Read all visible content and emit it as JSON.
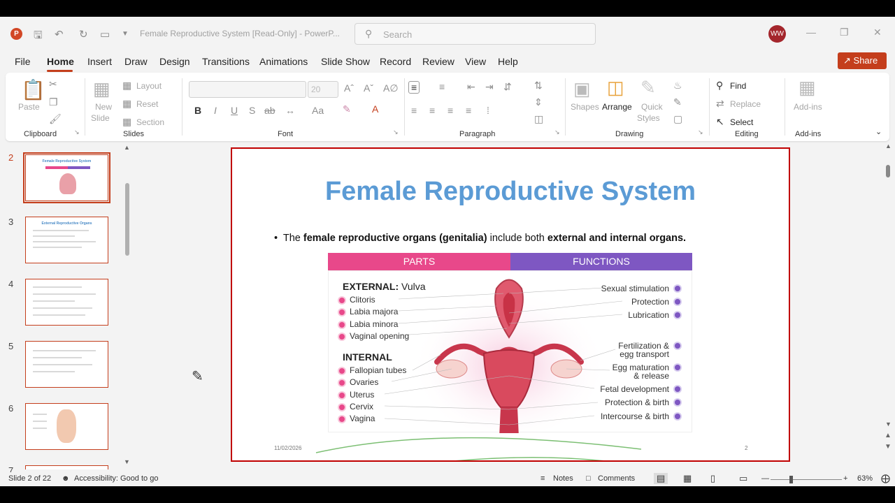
{
  "app": {
    "title": "Female Reproductive System [Read-Only]  -  PowerP...",
    "search_placeholder": "Search",
    "user_initials": "WW"
  },
  "menu": {
    "items": [
      "File",
      "Home",
      "Insert",
      "Draw",
      "Design",
      "Transitions",
      "Animations",
      "Slide Show",
      "Record",
      "Review",
      "View",
      "Help"
    ],
    "active": "Home",
    "share_label": "Share"
  },
  "ribbon": {
    "clipboard": {
      "label": "Clipboard",
      "paste": "Paste"
    },
    "slides": {
      "label": "Slides",
      "new_slide_1": "New",
      "new_slide_2": "Slide",
      "layout": "Layout",
      "reset": "Reset",
      "section": "Section"
    },
    "font": {
      "label": "Font",
      "size": "20",
      "bold": "B",
      "italic": "I",
      "underline": "U",
      "shadow": "S",
      "strike": "ab",
      "case": "Aa"
    },
    "paragraph": {
      "label": "Paragraph"
    },
    "drawing": {
      "label": "Drawing",
      "shapes": "Shapes",
      "arrange": "Arrange",
      "quick_1": "Quick",
      "quick_2": "Styles"
    },
    "editing": {
      "label": "Editing",
      "find": "Find",
      "replace": "Replace",
      "select": "Select"
    },
    "addins": {
      "label": "Add-ins",
      "button": "Add-ins"
    }
  },
  "thumbnails": [
    {
      "num": "2",
      "title": "Female Reproductive System",
      "active": true
    },
    {
      "num": "3",
      "title": "External Reproductive Organs",
      "active": false
    },
    {
      "num": "4",
      "title": "",
      "active": false
    },
    {
      "num": "5",
      "title": "",
      "active": false
    },
    {
      "num": "6",
      "title": "",
      "active": false
    },
    {
      "num": "7",
      "title": "",
      "active": false
    }
  ],
  "slide": {
    "title": "Female Reproductive System",
    "bullet_pre": "The ",
    "bullet_b1": "female reproductive organs (genitalia)",
    "bullet_mid": " include both ",
    "bullet_b2": "external and internal organs.",
    "parts_header": "PARTS",
    "functions_header": "FUNCTIONS",
    "external_label": "EXTERNAL:",
    "external_sub": " Vulva",
    "internal_label": "INTERNAL",
    "external_parts": [
      "Clitoris",
      "Labia majora",
      "Labia minora",
      "Vaginal opening"
    ],
    "internal_parts": [
      "Fallopian tubes",
      "Ovaries",
      "Uterus",
      "Cervix",
      "Vagina"
    ],
    "functions": {
      "f1": "Sexual stimulation",
      "f2": "Protection",
      "f3": "Lubrication",
      "f4a": "Fertilization &",
      "f4b": "egg transport",
      "f5a": "Egg maturation",
      "f5b": "& release",
      "f6": "Fetal development",
      "f7": "Protection & birth",
      "f8": "Intercourse & birth"
    },
    "date": "11/02/2026",
    "number": "2"
  },
  "status": {
    "slide_of": "Slide 2 of 22",
    "accessibility": "Accessibility: Good to go",
    "notes": "Notes",
    "comments": "Comments",
    "zoom": "63%"
  },
  "colors": {
    "accent": "#c43e1c",
    "parts": "#e8488a",
    "functions": "#7e57c2",
    "title": "#5b9bd5"
  }
}
